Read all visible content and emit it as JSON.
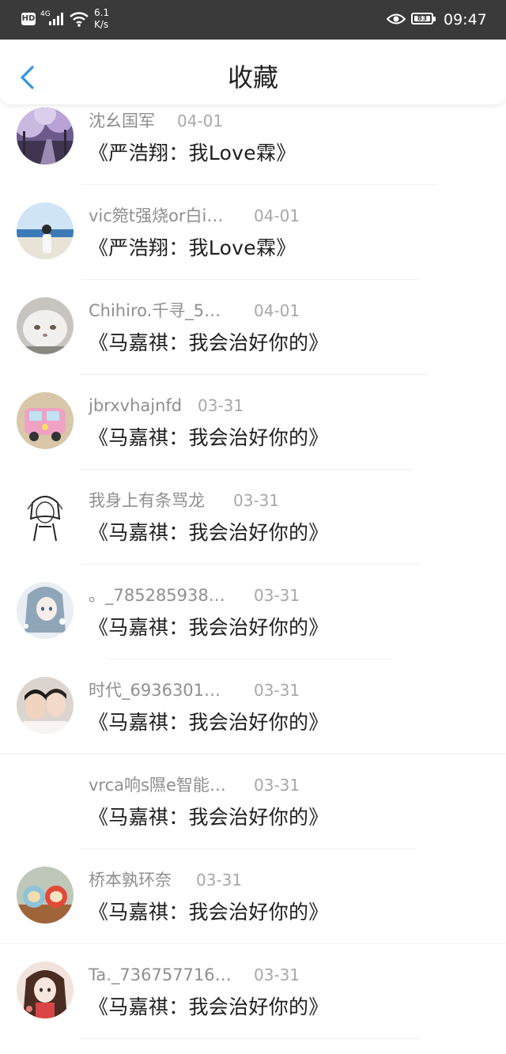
{
  "status_bar": {
    "hd_badge": "HD",
    "network": "4G",
    "speed_value": "6.1",
    "speed_unit": "K/s",
    "battery": "83",
    "time": "09:47",
    "icons": [
      "hd-icon",
      "signal-icon",
      "wifi-icon",
      "eye-icon",
      "battery-icon"
    ]
  },
  "header": {
    "title": "收藏",
    "back_icon": "chevron-left-icon",
    "accent_color": "#2f95e0"
  },
  "items": [
    {
      "name": "沈幺国军",
      "date": "04-01",
      "title": "《严浩翔：我Love霖》",
      "avatar": "photo"
    },
    {
      "name": "vic箢t强烧or白i…",
      "date": "04-01",
      "title": "《严浩翔：我Love霖》",
      "avatar": "photo"
    },
    {
      "name": "Chihiro.千寻_5…",
      "date": "04-01",
      "title": "《马嘉祺：我会治好你的》",
      "avatar": "photo"
    },
    {
      "name": "jbrxvhajnfd",
      "date": "03-31",
      "title": "《马嘉祺：我会治好你的》",
      "avatar": "photo"
    },
    {
      "name": "我身上有条骂龙",
      "date": "03-31",
      "title": "《马嘉祺：我会治好你的》",
      "avatar": "sketch"
    },
    {
      "name": "。_785285938…",
      "date": "03-31",
      "title": "《马嘉祺：我会治好你的》",
      "avatar": "illustration"
    },
    {
      "name": "时代_6936301…",
      "date": "03-31",
      "title": "《马嘉祺：我会治好你的》",
      "avatar": "photo"
    },
    {
      "name": "vrca响s隰e智能…",
      "date": "03-31",
      "title": "《马嘉祺：我会治好你的》",
      "avatar": "none"
    },
    {
      "name": "桥本孰环奈",
      "date": "03-31",
      "title": "《马嘉祺：我会治好你的》",
      "avatar": "photo"
    },
    {
      "name": "Ta._736757716…",
      "date": "03-31",
      "title": "《马嘉祺：我会治好你的》",
      "avatar": "illustration"
    }
  ]
}
